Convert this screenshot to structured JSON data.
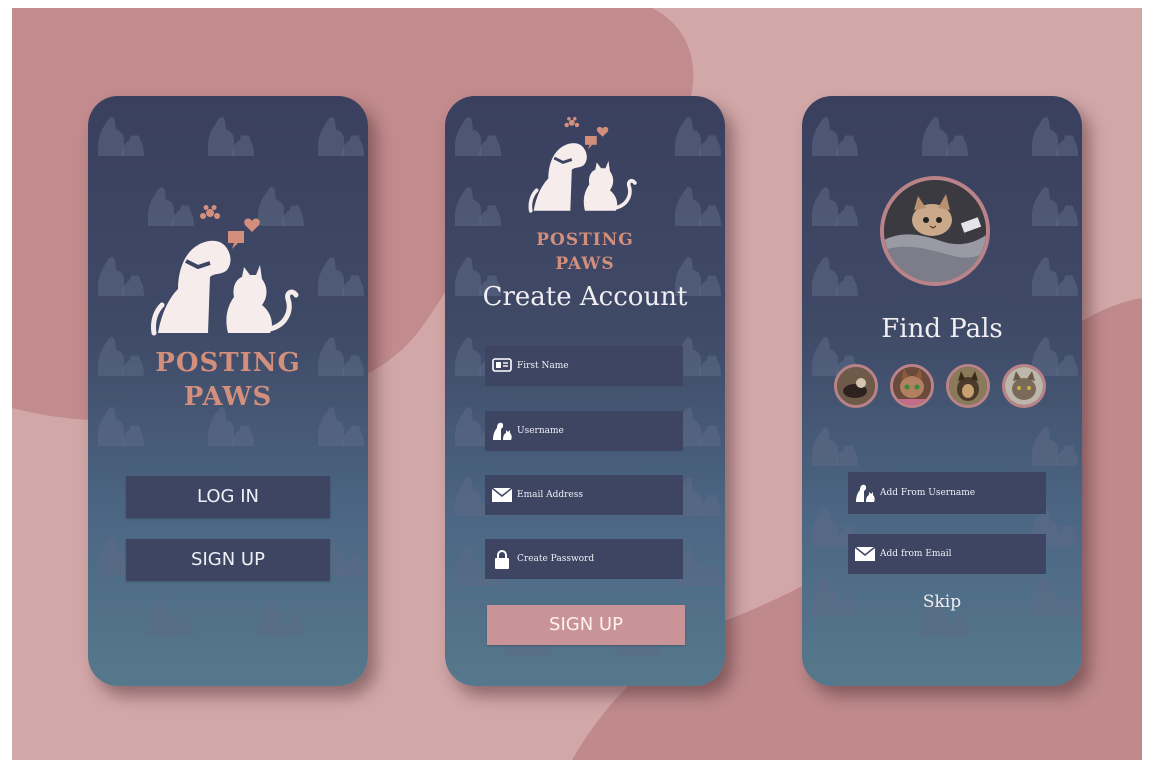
{
  "screen1": {
    "brand_line1": "POSTING",
    "brand_line2": "PAWS",
    "login_label": "LOG IN",
    "signup_label": "SIGN UP"
  },
  "screen2": {
    "brand_line1": "POSTING",
    "brand_line2": "PAWS",
    "title": "Create Account",
    "fields": [
      {
        "label": "First Name",
        "icon": "name-tag-icon"
      },
      {
        "label": "Username",
        "icon": "pets-icon"
      },
      {
        "label": "Email Address",
        "icon": "envelope-icon"
      },
      {
        "label": "Create Password",
        "icon": "lock-icon"
      }
    ],
    "signup_label": "SIGN UP"
  },
  "screen3": {
    "title": "Find Pals",
    "add_username_label": "Add From Username",
    "add_email_label": "Add from Email",
    "skip_label": "Skip"
  },
  "colors": {
    "background": "#d2a7a8",
    "phone_top": "#3a3f5e",
    "phone_bottom": "#56788c",
    "brand": "#d38f7c",
    "button": "#3e4562",
    "accent_button": "#c99497"
  }
}
